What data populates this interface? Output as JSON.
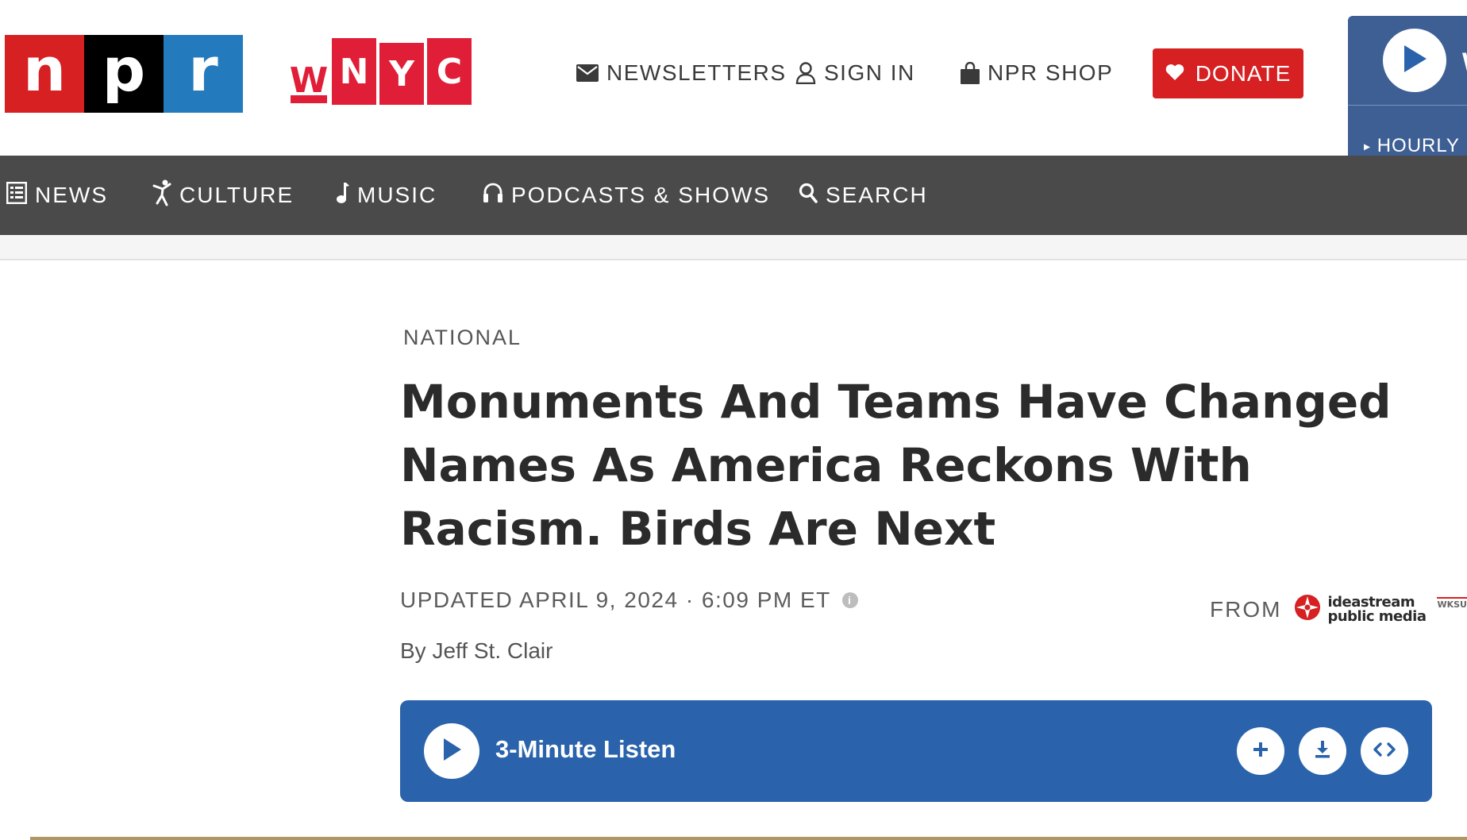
{
  "header": {
    "npr_logo": [
      "n",
      "p",
      "r"
    ],
    "wnyc_logo": [
      "W",
      "N",
      "Y",
      "C"
    ],
    "utility_links": {
      "newsletters": "NEWSLETTERS",
      "sign_in": "SIGN IN",
      "npr_shop": "NPR SHOP"
    },
    "donate_label": "DONATE",
    "live_player": {
      "partial_title": "W",
      "hourly_label": "HOURLY N"
    }
  },
  "nav": {
    "items": [
      {
        "label": "NEWS",
        "icon": "newspaper-icon"
      },
      {
        "label": "CULTURE",
        "icon": "dancer-icon"
      },
      {
        "label": "MUSIC",
        "icon": "music-note-icon"
      },
      {
        "label": "PODCASTS & SHOWS",
        "icon": "headphones-icon"
      },
      {
        "label": "SEARCH",
        "icon": "search-icon"
      }
    ]
  },
  "article": {
    "kicker": "NATIONAL",
    "headline": "Monuments And Teams Have Changed Names As America Reckons With Racism. Birds Are Next",
    "dateline": "UPDATED APRIL 9, 2024 · 6:09 PM ET",
    "byline": "By Jeff St. Clair",
    "from_label": "FROM",
    "source_logo": {
      "line1": "ideastream",
      "line2": "public media",
      "partner": "WKSU"
    },
    "player": {
      "label": "3-Minute Listen"
    }
  },
  "colors": {
    "npr_red": "#d62021",
    "npr_black": "#000000",
    "npr_blue": "#237bbd",
    "wnyc_red": "#e01e37",
    "nav_bg": "#4a4a4a",
    "player_blue": "#2a63ab",
    "live_box_blue": "#3e5f94"
  }
}
